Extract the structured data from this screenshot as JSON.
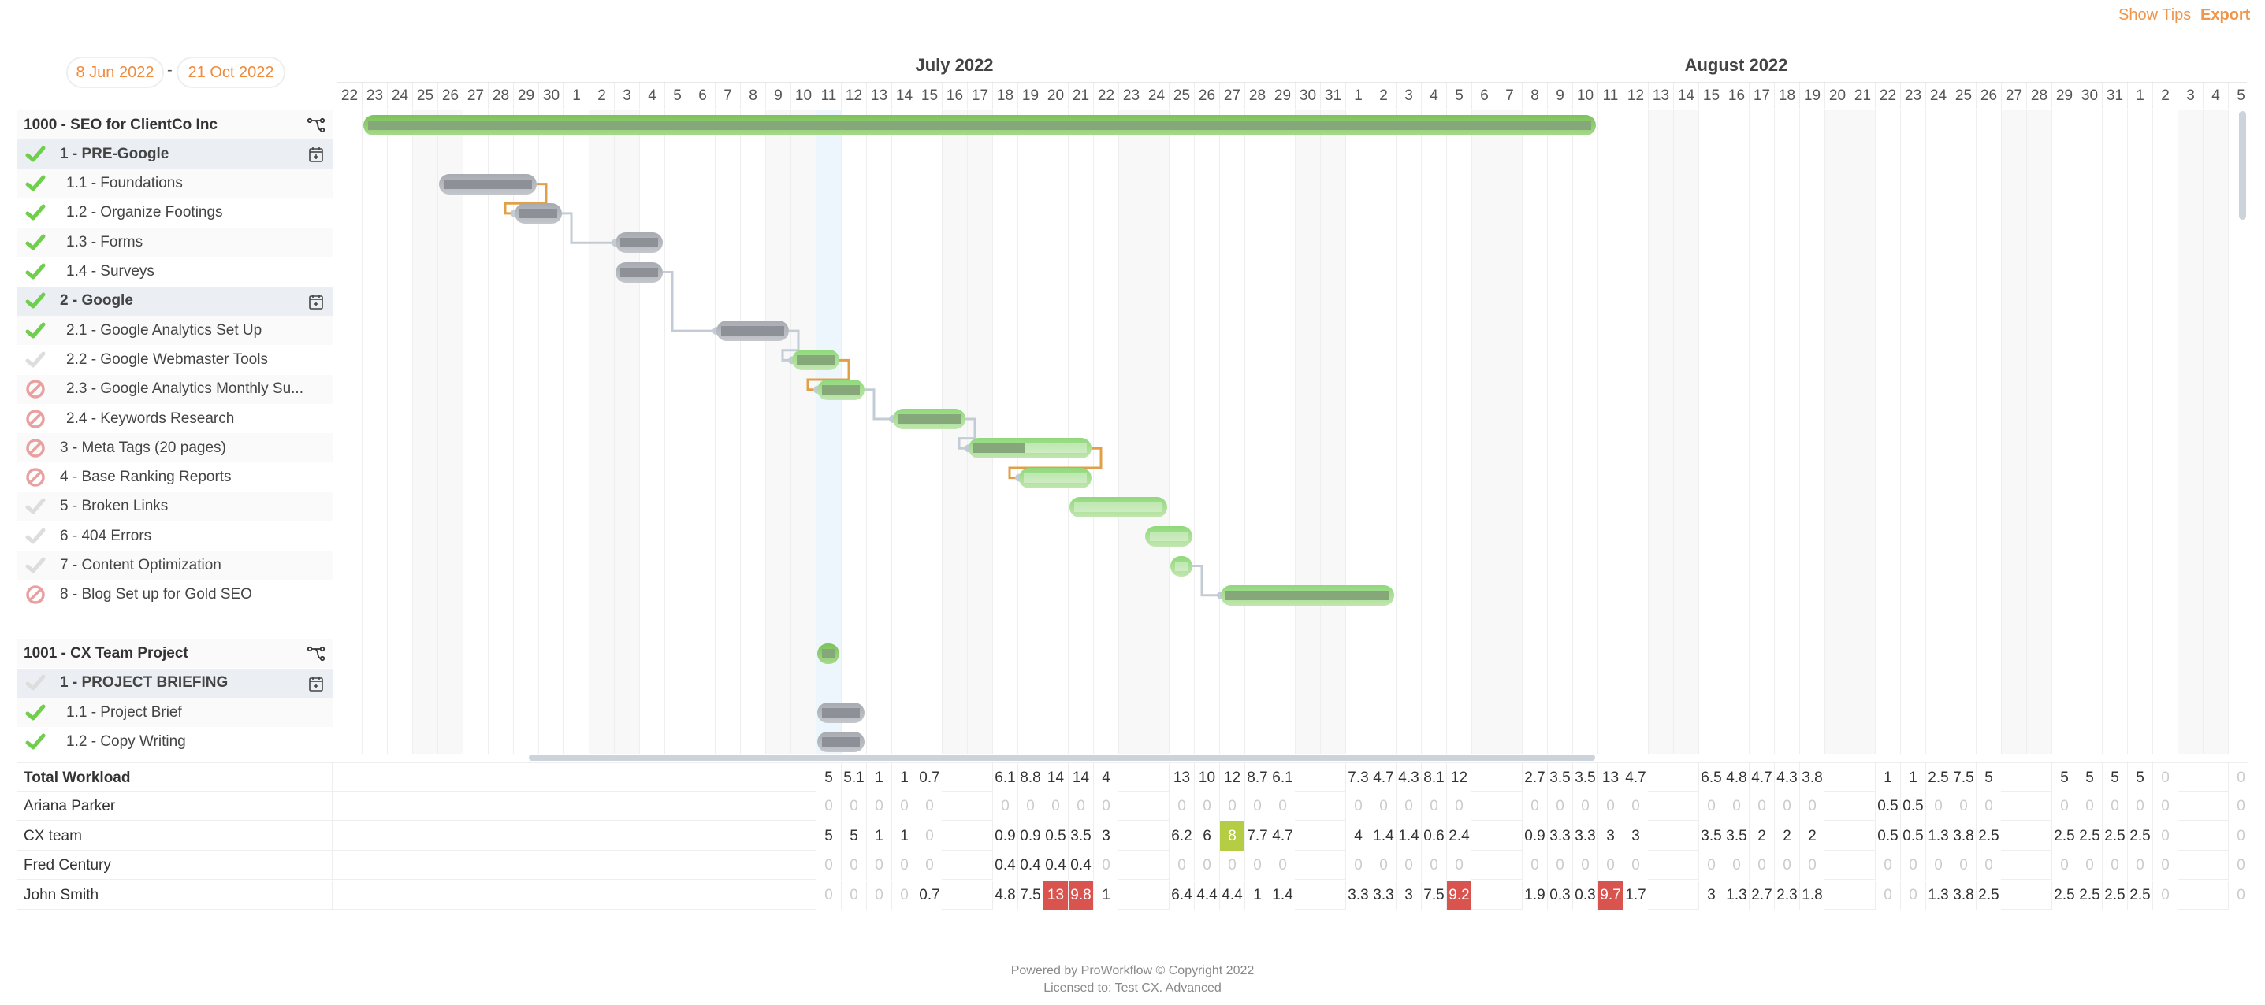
{
  "toolbar": {
    "show_tips": "Show Tips",
    "export": "Export",
    "accent": "#f08a3c"
  },
  "range": {
    "start": "8 Jun 2022",
    "end": "21 Oct 2022",
    "separator": "-"
  },
  "timeline": {
    "months": [
      {
        "label": "July 2022",
        "first_day": "2022-07-01",
        "last_day": "2022-07-31"
      },
      {
        "label": "August 2022",
        "first_day": "2022-08-01",
        "last_day": "2022-08-31"
      }
    ],
    "days": [
      22,
      23,
      24,
      25,
      26,
      27,
      28,
      29,
      30,
      1,
      2,
      3,
      4,
      5,
      6,
      7,
      8,
      9,
      10,
      11,
      12,
      13,
      14,
      15,
      16,
      17,
      18,
      19,
      20,
      21,
      22,
      23,
      24,
      25,
      26,
      27,
      28,
      29,
      30,
      31,
      1,
      2,
      3,
      4,
      5,
      6,
      7,
      8,
      9,
      10,
      11,
      12,
      13,
      14,
      15,
      16,
      17,
      18,
      19,
      20,
      21,
      22,
      23,
      24,
      25,
      26,
      27,
      28,
      29,
      30,
      31,
      1,
      2,
      3,
      4,
      5
    ],
    "today": "2022-07-11"
  },
  "rows": [
    {
      "label": "1000 - SEO for ClientCo Inc",
      "type": "project",
      "icon": "workflow-icon",
      "bar": {
        "start": "2022-06-23",
        "end": "2022-08-10",
        "progress": 100,
        "color": "green"
      }
    },
    {
      "label": "1 - PRE-Google",
      "type": "phase",
      "status": "done",
      "icon": "calendar-add-icon"
    },
    {
      "label": "1.1 - Foundations",
      "type": "subtask",
      "status": "done",
      "bar": {
        "start": "2022-06-26",
        "end": "2022-06-29",
        "progress": 100,
        "color": "gray"
      }
    },
    {
      "label": "1.2 - Organize Footings",
      "type": "subtask",
      "status": "done",
      "bar": {
        "start": "2022-06-29",
        "end": "2022-06-30",
        "progress": 100,
        "color": "gray"
      }
    },
    {
      "label": "1.3 - Forms",
      "type": "subtask",
      "status": "done",
      "bar": {
        "start": "2022-07-03",
        "end": "2022-07-04",
        "progress": 100,
        "color": "gray"
      }
    },
    {
      "label": "1.4 - Surveys",
      "type": "subtask",
      "status": "done",
      "bar": {
        "start": "2022-07-03",
        "end": "2022-07-04",
        "progress": 100,
        "color": "gray"
      }
    },
    {
      "label": "2 - Google",
      "type": "phase",
      "status": "done",
      "icon": "calendar-add-icon"
    },
    {
      "label": "2.1 - Google Analytics Set Up",
      "type": "subtask",
      "status": "done",
      "bar": {
        "start": "2022-07-07",
        "end": "2022-07-09",
        "progress": 100,
        "color": "gray"
      }
    },
    {
      "label": "2.2 - Google Webmaster Tools",
      "type": "subtask",
      "status": "pending",
      "bar": {
        "start": "2022-07-10",
        "end": "2022-07-11",
        "progress": 100,
        "color": "green"
      }
    },
    {
      "label": "2.3 - Google Analytics Monthly Su...",
      "type": "subtask",
      "status": "blocked",
      "bar": {
        "start": "2022-07-11",
        "end": "2022-07-12",
        "progress": 100,
        "color": "green"
      }
    },
    {
      "label": "2.4 - Keywords Research",
      "type": "subtask",
      "status": "blocked",
      "bar": {
        "start": "2022-07-14",
        "end": "2022-07-16",
        "progress": 100,
        "color": "green"
      }
    },
    {
      "label": "3 - Meta Tags (20 pages)",
      "type": "task",
      "status": "blocked",
      "bar": {
        "start": "2022-07-17",
        "end": "2022-07-21",
        "progress": 45,
        "color": "green"
      }
    },
    {
      "label": "4 - Base Ranking Reports",
      "type": "task",
      "status": "blocked",
      "bar": {
        "start": "2022-07-19",
        "end": "2022-07-21",
        "progress": 0,
        "color": "green"
      }
    },
    {
      "label": "5 - Broken Links",
      "type": "task",
      "status": "pending",
      "bar": {
        "start": "2022-07-21",
        "end": "2022-07-24",
        "progress": 0,
        "color": "green"
      }
    },
    {
      "label": "6 - 404 Errors",
      "type": "task",
      "status": "pending",
      "bar": {
        "start": "2022-07-24",
        "end": "2022-07-25",
        "progress": 0,
        "color": "green"
      }
    },
    {
      "label": "7 - Content Optimization",
      "type": "task",
      "status": "pending",
      "bar": {
        "start": "2022-07-25",
        "end": "2022-07-25",
        "progress": 0,
        "color": "green"
      }
    },
    {
      "label": "8 - Blog Set up for Gold SEO",
      "type": "task",
      "status": "blocked",
      "bar": {
        "start": "2022-07-27",
        "end": "2022-08-02",
        "progress": 100,
        "color": "green"
      }
    },
    {
      "label": "",
      "type": "spacer"
    },
    {
      "label": "1001 - CX Team Project",
      "type": "project",
      "icon": "workflow-icon",
      "bar": {
        "start": "2022-07-11",
        "end": "2022-07-11",
        "progress": 100,
        "color": "green"
      }
    },
    {
      "label": "1 - PROJECT BRIEFING",
      "type": "phase",
      "status": "pending",
      "icon": "calendar-add-icon"
    },
    {
      "label": "1.1 - Project Brief",
      "type": "subtask",
      "status": "done",
      "bar": {
        "start": "2022-07-11",
        "end": "2022-07-12",
        "progress": 100,
        "color": "gray"
      }
    },
    {
      "label": "1.2 - Copy Writing",
      "type": "subtask",
      "status": "done",
      "bar": {
        "start": "2022-07-11",
        "end": "2022-07-12",
        "progress": 100,
        "color": "gray"
      }
    }
  ],
  "dependencies": [
    {
      "from": "1.1 - Foundations",
      "to": "1.2 - Organize Footings",
      "color": "#e0a04a"
    },
    {
      "from": "1.2 - Organize Footings",
      "to": "1.3 - Forms",
      "color": "#c3ccd4"
    },
    {
      "from": "1.4 - Surveys",
      "to": "2.1 - Google Analytics Set Up",
      "color": "#c3ccd4"
    },
    {
      "from": "2.1 - Google Analytics Set Up",
      "to": "2.2 - Google Webmaster Tools",
      "color": "#c3ccd4"
    },
    {
      "from": "2.2 - Google Webmaster Tools",
      "to": "2.3 - Google Analytics Monthly Su...",
      "color": "#e0a04a"
    },
    {
      "from": "2.3 - Google Analytics Monthly Su...",
      "to": "2.4 - Keywords Research",
      "color": "#c3ccd4"
    },
    {
      "from": "2.4 - Keywords Research",
      "to": "3 - Meta Tags (20 pages)",
      "color": "#c3ccd4"
    },
    {
      "from": "3 - Meta Tags (20 pages)",
      "to": "4 - Base Ranking Reports",
      "color": "#e0a04a"
    },
    {
      "from": "7 - Content Optimization",
      "to": "8 - Blog Set up for Gold SEO",
      "color": "#c3ccd4"
    }
  ],
  "workload": {
    "rows": [
      {
        "label": "Total Workload",
        "values": [
          null,
          null,
          null,
          null,
          null,
          null,
          null,
          null,
          null,
          null,
          null,
          null,
          null,
          null,
          null,
          null,
          null,
          null,
          null,
          5,
          5.1,
          1,
          1,
          0.7,
          null,
          null,
          6.1,
          8.8,
          14,
          14,
          4,
          null,
          null,
          13,
          10,
          12,
          8.7,
          6.1,
          null,
          null,
          7.3,
          4.7,
          4.3,
          8.1,
          12,
          null,
          null,
          2.7,
          3.5,
          3.5,
          13,
          4.7,
          null,
          null,
          6.5,
          4.8,
          4.7,
          4.3,
          3.8,
          null,
          null,
          1,
          1,
          2.5,
          7.5,
          5,
          null,
          null,
          5,
          5,
          5,
          5,
          0,
          null,
          null,
          0
        ],
        "highlights": []
      },
      {
        "label": "Ariana Parker",
        "values": [
          null,
          null,
          null,
          null,
          null,
          null,
          null,
          null,
          null,
          null,
          null,
          null,
          null,
          null,
          null,
          null,
          null,
          null,
          null,
          0,
          0,
          0,
          0,
          0,
          null,
          null,
          0,
          0,
          0,
          0,
          0,
          null,
          null,
          0,
          0,
          0,
          0,
          0,
          null,
          null,
          0,
          0,
          0,
          0,
          0,
          null,
          null,
          0,
          0,
          0,
          0,
          0,
          null,
          null,
          0,
          0,
          0,
          0,
          0,
          null,
          null,
          0.5,
          0.5,
          0,
          0,
          0,
          null,
          null,
          0,
          0,
          0,
          0,
          0,
          null,
          null,
          0
        ],
        "highlights": []
      },
      {
        "label": "CX team",
        "values": [
          null,
          null,
          null,
          null,
          null,
          null,
          null,
          null,
          null,
          null,
          null,
          null,
          null,
          null,
          null,
          null,
          null,
          null,
          null,
          5,
          5,
          1,
          1,
          0,
          null,
          null,
          0.9,
          0.9,
          0.5,
          3.5,
          3,
          null,
          null,
          6.2,
          6,
          8,
          7.7,
          4.7,
          null,
          null,
          4,
          1.4,
          1.4,
          0.6,
          2.4,
          null,
          null,
          0.9,
          3.3,
          3.3,
          3,
          3,
          null,
          null,
          3.5,
          3.5,
          2,
          2,
          2,
          null,
          null,
          0.5,
          0.5,
          1.3,
          3.8,
          2.5,
          null,
          null,
          2.5,
          2.5,
          2.5,
          2.5,
          0,
          null,
          null,
          0
        ],
        "highlights": [
          {
            "date": "2022-07-27",
            "status": "ok"
          }
        ]
      },
      {
        "label": "Fred Century",
        "values": [
          null,
          null,
          null,
          null,
          null,
          null,
          null,
          null,
          null,
          null,
          null,
          null,
          null,
          null,
          null,
          null,
          null,
          null,
          null,
          0,
          0,
          0,
          0,
          0,
          null,
          null,
          0.4,
          0.4,
          0.4,
          0.4,
          0,
          null,
          null,
          0,
          0,
          0,
          0,
          0,
          null,
          null,
          0,
          0,
          0,
          0,
          0,
          null,
          null,
          0,
          0,
          0,
          0,
          0,
          null,
          null,
          0,
          0,
          0,
          0,
          0,
          null,
          null,
          0,
          0,
          0,
          0,
          0,
          null,
          null,
          0,
          0,
          0,
          0,
          0,
          null,
          null,
          0
        ],
        "highlights": []
      },
      {
        "label": "John Smith",
        "values": [
          null,
          null,
          null,
          null,
          null,
          null,
          null,
          null,
          null,
          null,
          null,
          null,
          null,
          null,
          null,
          null,
          null,
          null,
          null,
          0,
          0,
          0,
          0,
          0.7,
          null,
          null,
          4.8,
          7.5,
          13,
          9.8,
          1,
          null,
          null,
          6.4,
          4.4,
          4.4,
          1,
          1.4,
          null,
          null,
          3.3,
          3.3,
          3,
          7.5,
          9.2,
          null,
          null,
          1.9,
          0.3,
          0.3,
          9.7,
          1.7,
          null,
          null,
          3,
          1.3,
          2.7,
          2.3,
          1.8,
          null,
          null,
          0,
          0,
          1.3,
          3.8,
          2.5,
          null,
          null,
          2.5,
          2.5,
          2.5,
          2.5,
          0,
          null,
          null,
          0
        ],
        "highlights": [
          {
            "date": "2022-07-20",
            "status": "over"
          },
          {
            "date": "2022-07-21",
            "status": "over"
          },
          {
            "date": "2022-08-05",
            "status": "over"
          },
          {
            "date": "2022-08-11",
            "status": "over"
          }
        ]
      }
    ],
    "colors": {
      "over": "#d9534f",
      "ok": "#b5cc45"
    }
  },
  "footer": {
    "powered_prefix": "Powered by ",
    "brand": "ProWorkflow",
    "powered_suffix": " © Copyright 2022",
    "licensed": "Licensed to: Test CX. Advanced"
  }
}
